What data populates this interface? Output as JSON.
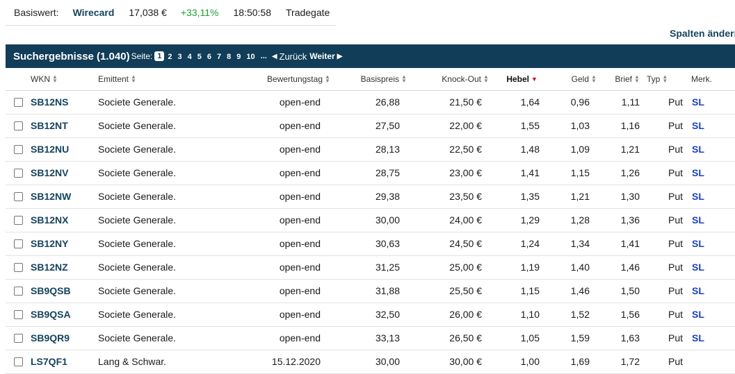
{
  "info": {
    "label": "Basiswert:",
    "name": "Wirecard",
    "price": "17,038 €",
    "change": "+33,11%",
    "time": "18:50:58",
    "exchange": "Tradegate"
  },
  "spalten_label": "Spalten ändern",
  "results": {
    "title": "Suchergebnisse (1.040)",
    "seite_label": "Seite:",
    "current_page": "1",
    "pages": [
      "2",
      "3",
      "4",
      "5",
      "6",
      "7",
      "8",
      "9",
      "10"
    ],
    "ellipsis": "...",
    "prev_label": "Zurück",
    "next_label": "Weiter"
  },
  "columns": {
    "wkn": "WKN",
    "emittent": "Emittent",
    "bewertungstag": "Bewertungstag",
    "basispreis": "Basispreis",
    "knockout": "Knock-Out",
    "hebel": "Hebel",
    "geld": "Geld",
    "brief": "Brief",
    "typ": "Typ",
    "merk": "Merk."
  },
  "colors": {
    "header_bg": "#113d58",
    "link": "#15445e",
    "positive": "#1aa328",
    "sort_active": "#d0021b",
    "sl": "#1a3fc6"
  },
  "rows": [
    {
      "wkn": "SB12NS",
      "emittent": "Societe Generale.",
      "bewertungstag": "open-end",
      "basispreis": "26,88",
      "knockout": "21,50 €",
      "hebel": "1,64",
      "geld": "0,96",
      "brief": "1,11",
      "typ": "Put",
      "merk": "SL"
    },
    {
      "wkn": "SB12NT",
      "emittent": "Societe Generale.",
      "bewertungstag": "open-end",
      "basispreis": "27,50",
      "knockout": "22,00 €",
      "hebel": "1,55",
      "geld": "1,03",
      "brief": "1,16",
      "typ": "Put",
      "merk": "SL"
    },
    {
      "wkn": "SB12NU",
      "emittent": "Societe Generale.",
      "bewertungstag": "open-end",
      "basispreis": "28,13",
      "knockout": "22,50 €",
      "hebel": "1,48",
      "geld": "1,09",
      "brief": "1,21",
      "typ": "Put",
      "merk": "SL"
    },
    {
      "wkn": "SB12NV",
      "emittent": "Societe Generale.",
      "bewertungstag": "open-end",
      "basispreis": "28,75",
      "knockout": "23,00 €",
      "hebel": "1,41",
      "geld": "1,15",
      "brief": "1,26",
      "typ": "Put",
      "merk": "SL"
    },
    {
      "wkn": "SB12NW",
      "emittent": "Societe Generale.",
      "bewertungstag": "open-end",
      "basispreis": "29,38",
      "knockout": "23,50 €",
      "hebel": "1,35",
      "geld": "1,21",
      "brief": "1,30",
      "typ": "Put",
      "merk": "SL"
    },
    {
      "wkn": "SB12NX",
      "emittent": "Societe Generale.",
      "bewertungstag": "open-end",
      "basispreis": "30,00",
      "knockout": "24,00 €",
      "hebel": "1,29",
      "geld": "1,28",
      "brief": "1,36",
      "typ": "Put",
      "merk": "SL"
    },
    {
      "wkn": "SB12NY",
      "emittent": "Societe Generale.",
      "bewertungstag": "open-end",
      "basispreis": "30,63",
      "knockout": "24,50 €",
      "hebel": "1,24",
      "geld": "1,34",
      "brief": "1,41",
      "typ": "Put",
      "merk": "SL"
    },
    {
      "wkn": "SB12NZ",
      "emittent": "Societe Generale.",
      "bewertungstag": "open-end",
      "basispreis": "31,25",
      "knockout": "25,00 €",
      "hebel": "1,19",
      "geld": "1,40",
      "brief": "1,46",
      "typ": "Put",
      "merk": "SL"
    },
    {
      "wkn": "SB9QSB",
      "emittent": "Societe Generale.",
      "bewertungstag": "open-end",
      "basispreis": "31,88",
      "knockout": "25,50 €",
      "hebel": "1,15",
      "geld": "1,46",
      "brief": "1,50",
      "typ": "Put",
      "merk": "SL"
    },
    {
      "wkn": "SB9QSA",
      "emittent": "Societe Generale.",
      "bewertungstag": "open-end",
      "basispreis": "32,50",
      "knockout": "26,00 €",
      "hebel": "1,10",
      "geld": "1,52",
      "brief": "1,56",
      "typ": "Put",
      "merk": "SL"
    },
    {
      "wkn": "SB9QR9",
      "emittent": "Societe Generale.",
      "bewertungstag": "open-end",
      "basispreis": "33,13",
      "knockout": "26,50 €",
      "hebel": "1,05",
      "geld": "1,59",
      "brief": "1,63",
      "typ": "Put",
      "merk": "SL"
    },
    {
      "wkn": "LS7QF1",
      "emittent": "Lang & Schwar.",
      "bewertungstag": "15.12.2020",
      "basispreis": "30,00",
      "knockout": "30,00 €",
      "hebel": "1,00",
      "geld": "1,69",
      "brief": "1,72",
      "typ": "Put",
      "merk": ""
    }
  ]
}
